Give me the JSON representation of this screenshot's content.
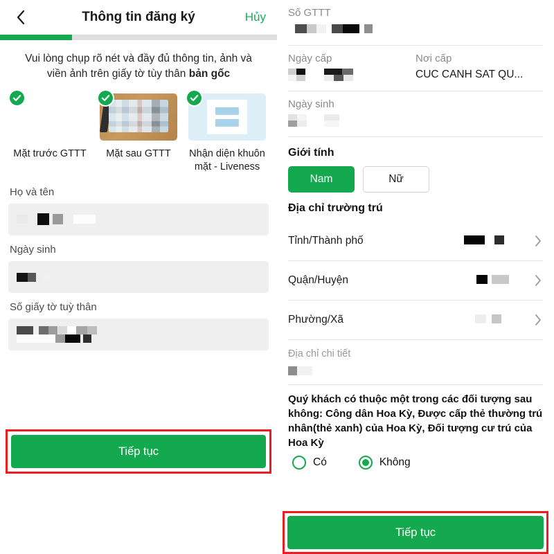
{
  "left": {
    "header": {
      "back_icon": "chevron-left-icon",
      "title": "Thông tin đăng ký",
      "cancel_label": "Hủy"
    },
    "progress": {
      "percent": 26
    },
    "instruction_line1": "Vui lòng chụp rõ nét và đầy đủ thông tin, ảnh và",
    "instruction_line2_prefix": "viền ảnh trên giấy tờ tùy thân ",
    "instruction_line2_bold": "bản gốc",
    "thumbnails": [
      {
        "label": "Mặt trước GTTT",
        "kind": "blank",
        "checked": true,
        "check_icon": "check-circle-icon"
      },
      {
        "label": "Mặt sau GTTT",
        "kind": "card-photo",
        "checked": true,
        "check_icon": "check-circle-icon"
      },
      {
        "label": "Nhận diện khuôn mặt - Liveness",
        "kind": "liveness",
        "checked": true,
        "check_icon": "check-circle-icon"
      }
    ],
    "fields": [
      {
        "label": "Họ và tên",
        "value": ""
      },
      {
        "label": "Ngày sinh",
        "value": ""
      },
      {
        "label": "Số giấy tờ tuỳ thân",
        "value": ""
      }
    ],
    "cta_label": "Tiếp tục"
  },
  "right": {
    "id_number": {
      "label": "Số GTTT",
      "value": ""
    },
    "issue_date": {
      "label": "Ngày cấp",
      "value": ""
    },
    "issue_place": {
      "label": "Nơi cấp",
      "value": "CUC CANH SAT QU..."
    },
    "birth_date": {
      "label": "Ngày sinh",
      "value": ""
    },
    "gender": {
      "title": "Giới tính",
      "options": [
        {
          "label": "Nam",
          "selected": true
        },
        {
          "label": "Nữ",
          "selected": false
        }
      ]
    },
    "address": {
      "title": "Địa chỉ trường trú",
      "rows": [
        {
          "label": "Tỉnh/Thành phố",
          "value": "",
          "chevron_icon": "chevron-right-icon"
        },
        {
          "label": "Quận/Huyện",
          "value": "",
          "chevron_icon": "chevron-right-icon"
        },
        {
          "label": "Phường/Xã",
          "value": "",
          "chevron_icon": "chevron-right-icon"
        }
      ],
      "detail": {
        "label": "Địa chỉ chi tiết",
        "value": ""
      }
    },
    "question": {
      "text": "Quý khách có thuộc một trong các đối tượng sau không: Công dân Hoa Kỳ, Được cấp thẻ thường trú nhân(thẻ xanh) của Hoa Kỳ, Đối tượng cư trú của Hoa Kỳ",
      "options": [
        {
          "label": "Có",
          "selected": false
        },
        {
          "label": "Không",
          "selected": true
        }
      ]
    },
    "cta_label": "Tiếp tục"
  },
  "colors": {
    "brand_green": "#14a84f",
    "annotation_red": "#ee1c1c",
    "field_bg": "#efefef"
  }
}
